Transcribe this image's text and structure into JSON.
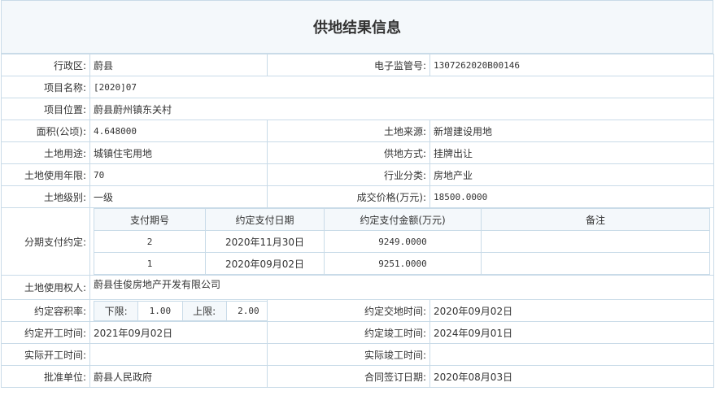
{
  "page_title": "供地结果信息",
  "labels": {
    "district": "行政区:",
    "supervise_no": "电子监管号:",
    "project_name": "项目名称:",
    "project_location": "项目位置:",
    "area": "面积(公顷):",
    "land_source": "土地来源:",
    "land_use": "土地用途:",
    "supply_mode": "供地方式:",
    "use_years": "土地使用年限:",
    "industry": "行业分类:",
    "land_level": "土地级别:",
    "deal_price": "成交价格(万元):",
    "installments": "分期支付约定:",
    "land_user": "土地使用权人:",
    "plot_ratio": "约定容积率:",
    "delivery_time": "约定交地时间:",
    "start_time": "约定开工时间:",
    "finish_time": "约定竣工时间:",
    "actual_start": "实际开工时间:",
    "actual_finish": "实际竣工时间:",
    "approver": "批准单位:",
    "contract_date": "合同签订日期:"
  },
  "values": {
    "district": "蔚县",
    "supervise_no": "1307262020B00146",
    "project_name": "[2020]07",
    "project_location": "蔚县蔚州镇东关村",
    "area": "4.648000",
    "land_source": "新增建设用地",
    "land_use": "城镇住宅用地",
    "supply_mode": "挂牌出让",
    "use_years": "70",
    "industry": "房地产业",
    "land_level": "一级",
    "deal_price": "18500.0000",
    "land_user": "蔚县佳俊房地产开发有限公司",
    "delivery_time": "2020年09月02日",
    "start_time": "2021年09月02日",
    "finish_time": "2024年09月01日",
    "actual_start": "",
    "actual_finish": "",
    "approver": "蔚县人民政府",
    "contract_date": "2020年08月03日"
  },
  "installments": {
    "headers": [
      "支付期号",
      "约定支付日期",
      "约定支付金额(万元)",
      "备注"
    ],
    "rows": [
      {
        "period": "2",
        "date": "2020年11月30日",
        "amount": "9249.0000",
        "note": ""
      },
      {
        "period": "1",
        "date": "2020年09月02日",
        "amount": "9251.0000",
        "note": ""
      }
    ]
  },
  "plot_ratio": {
    "lower_label": "下限:",
    "lower_value": "1.00",
    "upper_label": "上限:",
    "upper_value": "2.00"
  },
  "colors": {
    "border": "#c9dbe8",
    "header_bg": "#f4f8fb",
    "text": "#333333"
  }
}
